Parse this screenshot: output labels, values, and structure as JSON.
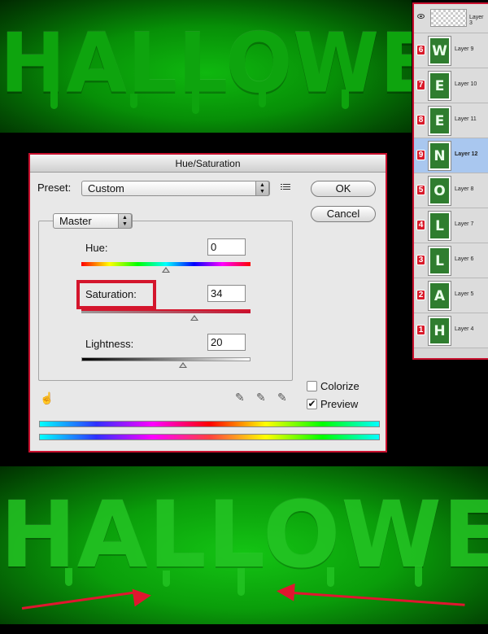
{
  "canvas": {
    "top_text": "HALLOWEEN",
    "bottom_text": "HALLOWEEN"
  },
  "layers": [
    {
      "number": "",
      "name": "Layer 3",
      "letter": "",
      "selected": false
    },
    {
      "number": "6",
      "name": "Layer 9",
      "letter": "W",
      "selected": false
    },
    {
      "number": "7",
      "name": "Layer 10",
      "letter": "E",
      "selected": false
    },
    {
      "number": "8",
      "name": "Layer 11",
      "letter": "E",
      "selected": false
    },
    {
      "number": "9",
      "name": "Layer 12",
      "letter": "N",
      "selected": true
    },
    {
      "number": "5",
      "name": "Layer 8",
      "letter": "O",
      "selected": false
    },
    {
      "number": "4",
      "name": "Layer 7",
      "letter": "L",
      "selected": false
    },
    {
      "number": "3",
      "name": "Layer 6",
      "letter": "L",
      "selected": false
    },
    {
      "number": "2",
      "name": "Layer 5",
      "letter": "A",
      "selected": false
    },
    {
      "number": "1",
      "name": "Layer 4",
      "letter": "H",
      "selected": false
    }
  ],
  "dialog": {
    "title": "Hue/Saturation",
    "preset_label": "Preset:",
    "preset_value": "Custom",
    "ok_label": "OK",
    "cancel_label": "Cancel",
    "channel_value": "Master",
    "hue": {
      "label": "Hue:",
      "value": "0",
      "level": 0.5
    },
    "saturation": {
      "label": "Saturation:",
      "value": "34",
      "level": 0.667
    },
    "lightness": {
      "label": "Lightness:",
      "value": "20",
      "level": 0.6
    },
    "colorize_label": "Colorize",
    "preview_label": "Preview",
    "colorize_checked": false,
    "preview_checked": true
  },
  "colors": {
    "highlight": "#d4152c",
    "selected_layer": "#a9c7ef"
  }
}
